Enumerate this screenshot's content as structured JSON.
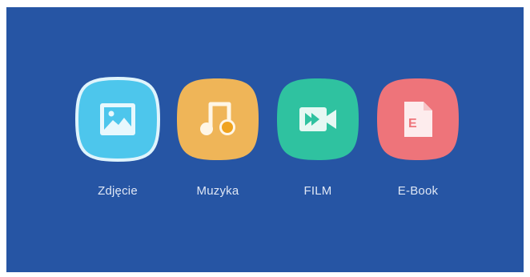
{
  "background_color": "#2655a4",
  "tiles": [
    {
      "label": "Zdjęcie",
      "icon": "image-icon",
      "color": "#4dc6ec",
      "selected": true
    },
    {
      "label": "Muzyka",
      "icon": "music-icon",
      "color": "#efb558",
      "selected": false
    },
    {
      "label": "FILM",
      "icon": "video-icon",
      "color": "#2fc2a0",
      "selected": false
    },
    {
      "label": "E-Book",
      "icon": "ebook-icon",
      "color": "#ee747a",
      "selected": false
    }
  ]
}
